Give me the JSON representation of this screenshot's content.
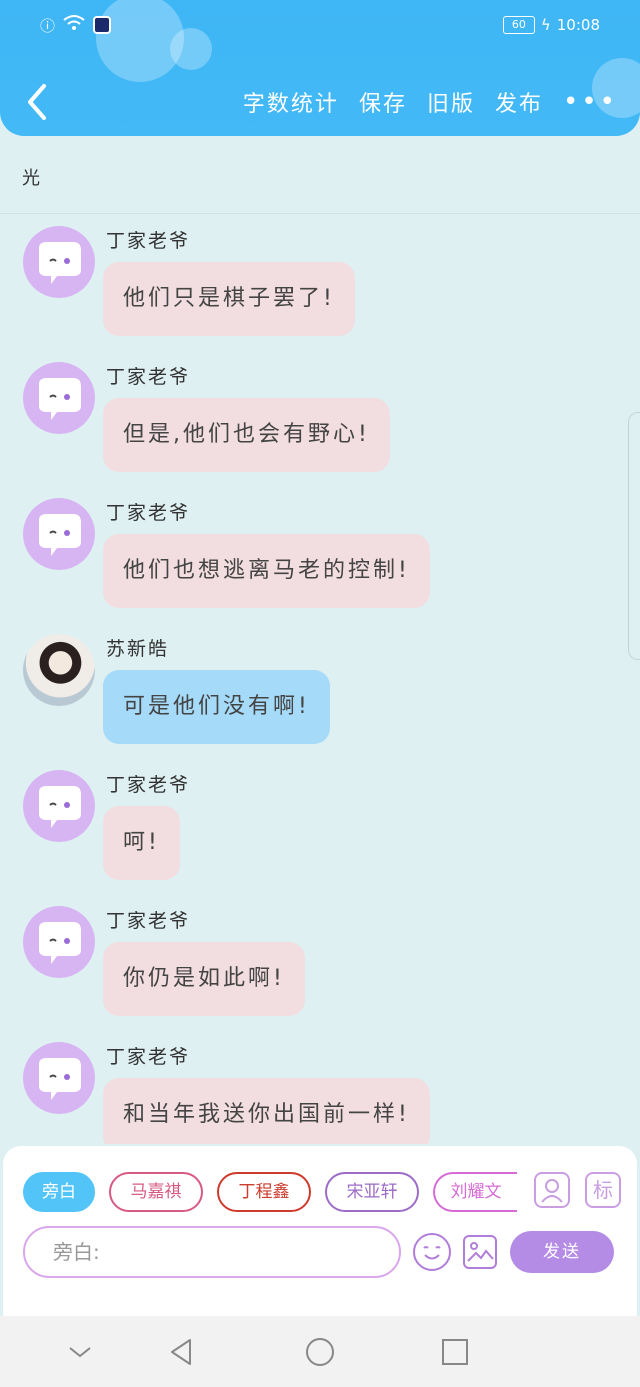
{
  "status": {
    "battery": "60",
    "time": "10:08"
  },
  "toolbar": {
    "word_count": "字数统计",
    "save": "保存",
    "old_version": "旧版",
    "publish": "发布",
    "more": "•••"
  },
  "topic": "光",
  "messages": [
    {
      "sender": "丁家老爷",
      "text": "他们只是棋子罢了!",
      "style": "pink"
    },
    {
      "sender": "丁家老爷",
      "text": "但是,他们也会有野心!",
      "style": "pink"
    },
    {
      "sender": "丁家老爷",
      "text": "他们也想逃离马老的控制!",
      "style": "pink"
    },
    {
      "sender": "苏新皓",
      "text": "可是他们没有啊!",
      "style": "blue"
    },
    {
      "sender": "丁家老爷",
      "text": "呵!",
      "style": "pink"
    },
    {
      "sender": "丁家老爷",
      "text": "你仍是如此啊!",
      "style": "pink"
    },
    {
      "sender": "丁家老爷",
      "text": "和当年我送你出国前一样!",
      "style": "pink"
    }
  ],
  "roles": [
    "旁白",
    "马嘉祺",
    "丁程鑫",
    "宋亚轩",
    "刘耀文"
  ],
  "tools": {
    "mark": "标"
  },
  "input": {
    "placeholder": "旁白:"
  },
  "send_label": "发送",
  "colors": {
    "header": "#3fb6f5",
    "background": "#dff0f2",
    "bubble_pink": "#f2dde0",
    "bubble_blue": "#a6daf9",
    "send": "#b48be5"
  }
}
